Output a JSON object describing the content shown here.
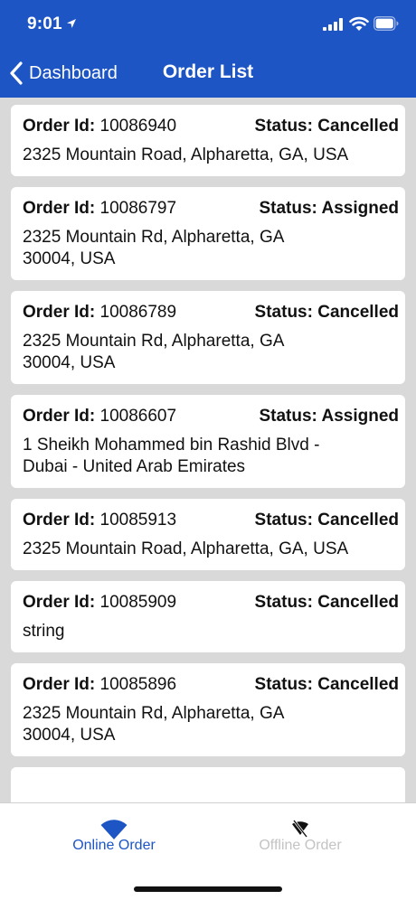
{
  "status_bar": {
    "time": "9:01"
  },
  "nav": {
    "back_label": "Dashboard",
    "title": "Order List"
  },
  "labels": {
    "order_id": "Order Id:",
    "status_prefix": "Status:"
  },
  "orders": [
    {
      "id": "10086940",
      "status": "Cancelled",
      "address": "2325 Mountain Road, Alpharetta, GA, USA"
    },
    {
      "id": "10086797",
      "status": "Assigned",
      "address": "2325 Mountain Rd, Alpharetta, GA 30004, USA"
    },
    {
      "id": "10086789",
      "status": "Cancelled",
      "address": "2325 Mountain Rd, Alpharetta, GA 30004, USA"
    },
    {
      "id": "10086607",
      "status": "Assigned",
      "address": "1 Sheikh Mohammed bin Rashid Blvd - Dubai - United Arab Emirates"
    },
    {
      "id": "10085913",
      "status": "Cancelled",
      "address": "2325 Mountain Road, Alpharetta, GA, USA"
    },
    {
      "id": "10085909",
      "status": "Cancelled",
      "address": "string"
    },
    {
      "id": "10085896",
      "status": "Cancelled",
      "address": "2325 Mountain Rd, Alpharetta, GA 30004, USA"
    }
  ],
  "tabs": {
    "online_label": "Online Order",
    "offline_label": "Offline Order"
  },
  "colors": {
    "header": "#1d55c4",
    "active_tab": "#1d55c4",
    "inactive_tab": "#c3c3c3",
    "list_background": "#d9d9d9"
  },
  "icons": {
    "location": "location-arrow-icon",
    "signal": "cellular-signal-icon",
    "wifi": "wifi-icon",
    "battery": "battery-icon",
    "back": "chevron-left-icon",
    "online_tab": "wifi-icon",
    "offline_tab": "wifi-off-icon"
  }
}
